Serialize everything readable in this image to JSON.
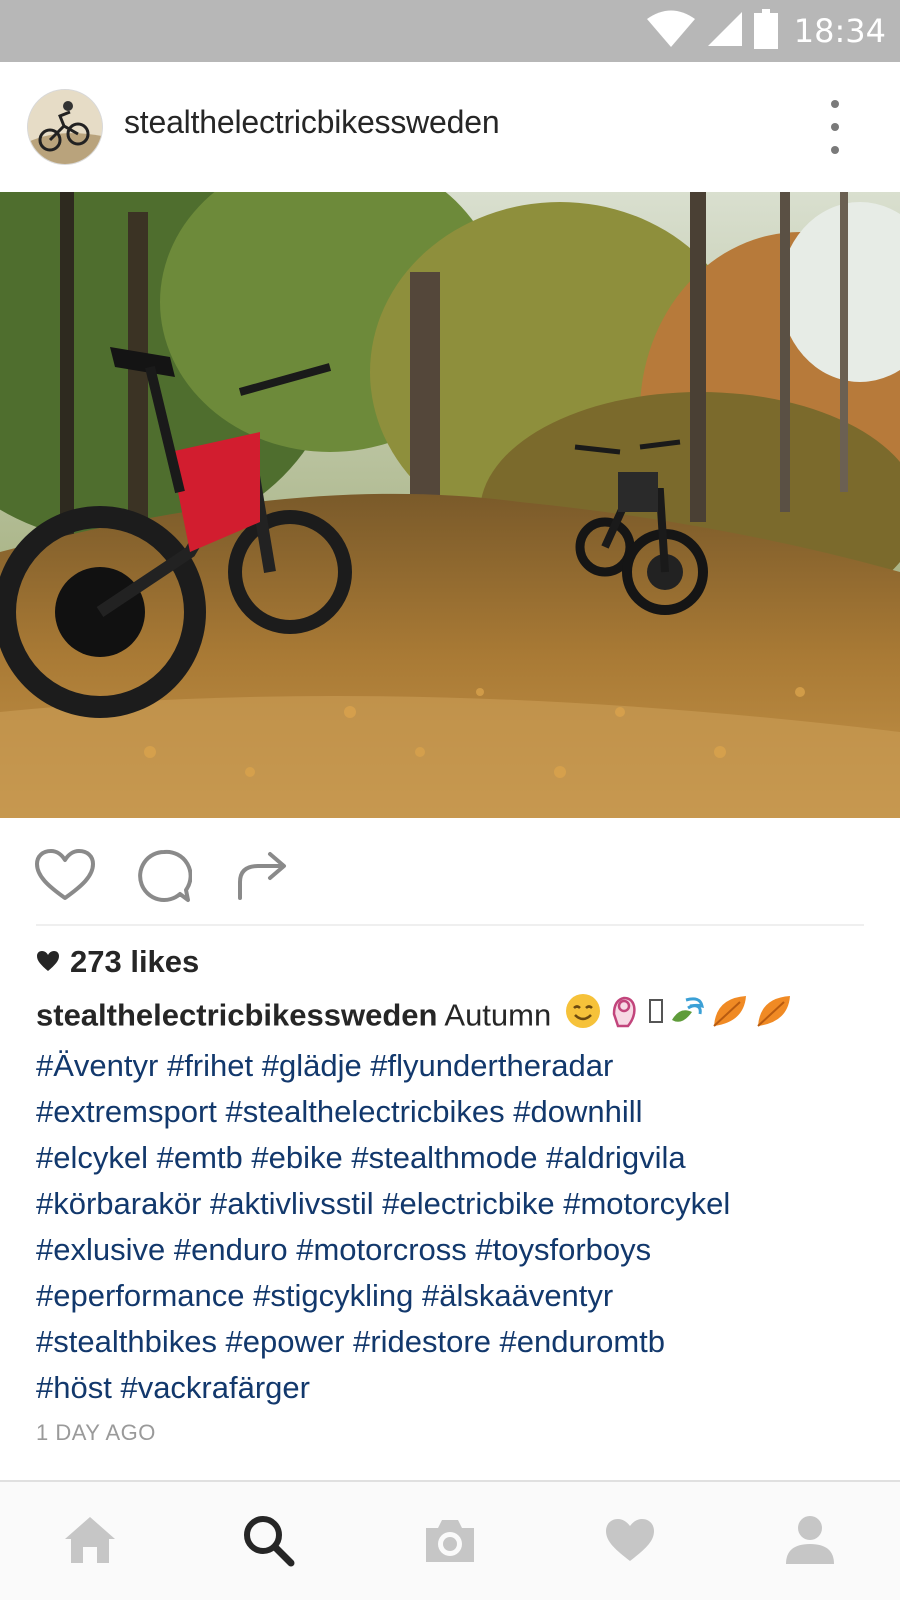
{
  "status_bar": {
    "time": "18:34"
  },
  "post": {
    "username": "stealthelectricbikessweden",
    "likes": "273 likes",
    "caption_author": "stealthelectricbikessweden",
    "caption_text": "Autumn",
    "hashtag_lines": [
      "#Äventyr #frihet #glädje #flyundertheradar",
      "#extremsport #stealthelectricbikes #downhill",
      "#elcykel #emtb #ebike #stealthmode #aldrigvila",
      "#körbarakör #aktivlivsstil #electricbike #motorcykel",
      "#exlusive  #enduro #motorcross #toysforboys",
      "#eperformance  #stigcykling #älskaäventyr",
      "#stealthbikes  #epower #ridestore #enduromtb",
      "#höst #vackrafärger"
    ],
    "time_ago": "1 DAY AGO"
  },
  "icons": {
    "status": [
      "wifi-icon",
      "cell-signal-icon",
      "battery-icon"
    ],
    "header": [
      "more-options-icon"
    ],
    "actions": [
      "like-heart-icon",
      "comment-icon",
      "share-icon"
    ],
    "bottom_nav": [
      "home-icon",
      "search-icon",
      "camera-icon",
      "activity-heart-icon",
      "profile-icon"
    ]
  },
  "colors": {
    "status_bar": "#b7b7b7",
    "hashtag": "#12386c",
    "text": "#262626",
    "muted": "#9a9a9a",
    "nav_icon": "#c6c6c6",
    "nav_active": "#262626"
  }
}
